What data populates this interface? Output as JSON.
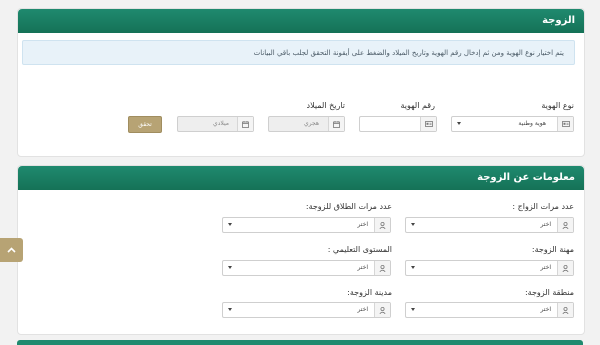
{
  "wife_section": {
    "title": "الزوجة",
    "notice": "يتم اختيار نوع الهوية ومن ثم إدخال رقم الهوية وتاريخ الميلاد والضغط على أيقونة التحقق لجلب باقي البيانات",
    "id_type": {
      "label": "نوع الهوية",
      "value": "هوية وطنية"
    },
    "id_number": {
      "label": "رقم الهوية",
      "value": ""
    },
    "birth_date": {
      "label": "تاريخ الميلاد",
      "hijri_placeholder": "هجري",
      "gregorian_placeholder": "ميلادي"
    },
    "verify_button": "تحقق"
  },
  "wife_info": {
    "title": "معلومات عن الزوجة",
    "marriages_count": {
      "label": "عدد مرات الزواج :",
      "value": "اختر"
    },
    "divorce_count": {
      "label": "عدد مرات الطلاق للزوجة:",
      "value": "اختر"
    },
    "occupation": {
      "label": "مهنة الزوجة:",
      "value": "اختر"
    },
    "education": {
      "label": "المستوى التعليمي :",
      "value": "اختر"
    },
    "region": {
      "label": "منطقة الزوجة:",
      "value": "اختر"
    },
    "city": {
      "label": "مدينة الزوجة:",
      "value": "اختر"
    }
  },
  "colors": {
    "header": "#1a7d63",
    "accent": "#b7a374"
  },
  "icons": {
    "card": "id-card-icon",
    "calendar": "calendar-icon",
    "user": "user-icon",
    "scroll": "chevron-up-icon"
  }
}
